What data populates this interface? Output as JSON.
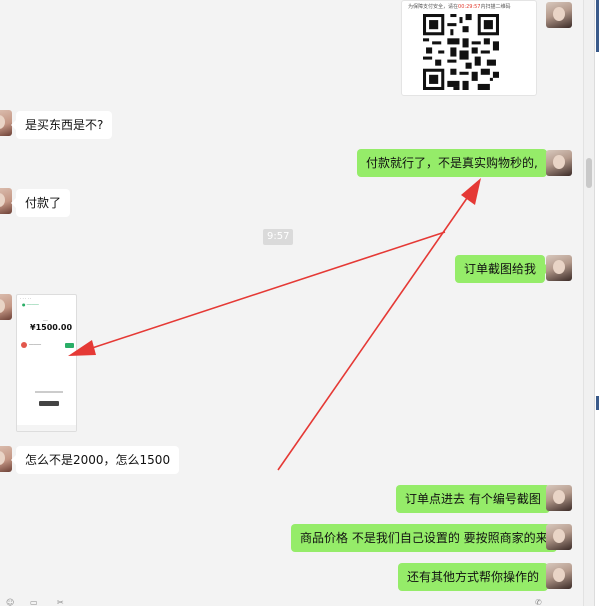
{
  "qr_card": {
    "caption_prefix": "为保障支付安全，请在",
    "caption_time": "00:29:57",
    "caption_suffix": "内扫描二维码"
  },
  "messages": [
    {
      "side": "in",
      "text": "是买东西是不?"
    },
    {
      "side": "out",
      "text": "付款就行了，不是真实购物秒的,"
    },
    {
      "side": "in",
      "text": "付款了"
    },
    {
      "side": "out",
      "text": "订单截图给我"
    },
    {
      "side": "in",
      "text": "怎么不是2000，怎么1500"
    },
    {
      "side": "out",
      "text": "订单点进去 有个编号截图"
    },
    {
      "side": "out",
      "text": "商品价格 不是我们自己设置的  要按照商家的来"
    },
    {
      "side": "out",
      "text": "还有其他方式帮你操作的"
    }
  ],
  "timestamp": "9:57",
  "payment_screenshot": {
    "amount": "¥1500.00",
    "accent_color": "#2aae67"
  },
  "colors": {
    "outgoing_bubble": "#95ec69",
    "incoming_bubble": "#ffffff",
    "annotation_arrow": "#e53935",
    "background": "#f3f3f3"
  }
}
